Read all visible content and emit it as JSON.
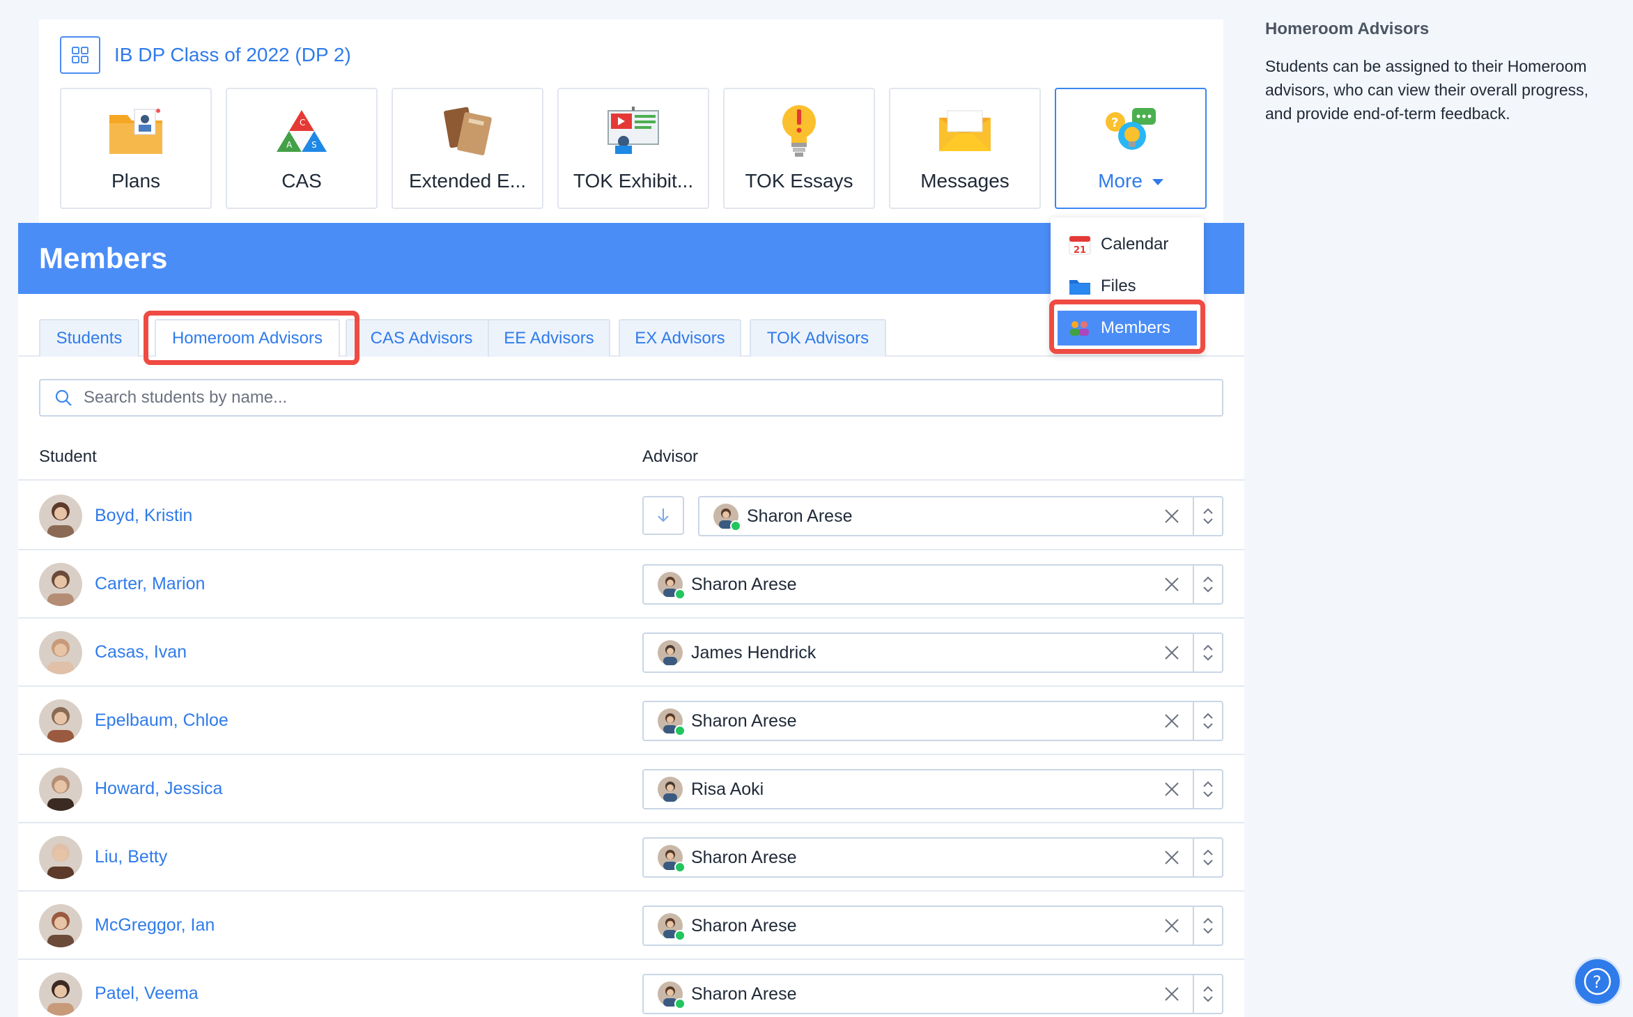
{
  "class": {
    "title": "IB DP Class of 2022 (DP 2)"
  },
  "tiles": [
    {
      "label": "Plans",
      "icon": "plans-folder-icon"
    },
    {
      "label": "CAS",
      "icon": "cas-triangle-icon"
    },
    {
      "label": "Extended E...",
      "icon": "extended-essay-books-icon"
    },
    {
      "label": "TOK Exhibit...",
      "icon": "tok-exhibition-icon"
    },
    {
      "label": "TOK Essays",
      "icon": "lightbulb-alert-icon"
    },
    {
      "label": "Messages",
      "icon": "envelope-icon"
    },
    {
      "label": "More",
      "icon": "more-bubbles-icon"
    }
  ],
  "more_menu": {
    "items": [
      {
        "label": "Calendar",
        "icon": "calendar-icon",
        "badge": "21"
      },
      {
        "label": "Files",
        "icon": "folder-icon"
      },
      {
        "label": "Members",
        "icon": "members-icon"
      }
    ]
  },
  "members": {
    "title": "Members",
    "tabs": [
      "Students",
      "Homeroom Advisors",
      "CAS Advisors",
      "EE Advisors",
      "EX Advisors",
      "TOK Advisors"
    ],
    "search_placeholder": "Search students by name...",
    "columns": {
      "student": "Student",
      "advisor": "Advisor"
    },
    "rows": [
      {
        "student": "Boyd, Kristin",
        "advisor": "Sharon Arese"
      },
      {
        "student": "Carter, Marion",
        "advisor": "Sharon Arese"
      },
      {
        "student": "Casas, Ivan",
        "advisor": "James Hendrick"
      },
      {
        "student": "Epelbaum, Chloe",
        "advisor": "Sharon Arese"
      },
      {
        "student": "Howard, Jessica",
        "advisor": "Risa Aoki"
      },
      {
        "student": "Liu, Betty",
        "advisor": "Sharon Arese"
      },
      {
        "student": "McGreggor, Ian",
        "advisor": "Sharon Arese"
      },
      {
        "student": "Patel, Veema",
        "advisor": "Sharon Arese"
      }
    ]
  },
  "help": {
    "title": "Homeroom Advisors",
    "text": "Students can be assigned to their Homeroom advisors, who can view their overall progress, and provide end-of-term feedback."
  },
  "colors": {
    "accent": "#2f7bea",
    "banner": "#4a8df7",
    "highlight": "#ef4b43",
    "online": "#22c55e"
  }
}
